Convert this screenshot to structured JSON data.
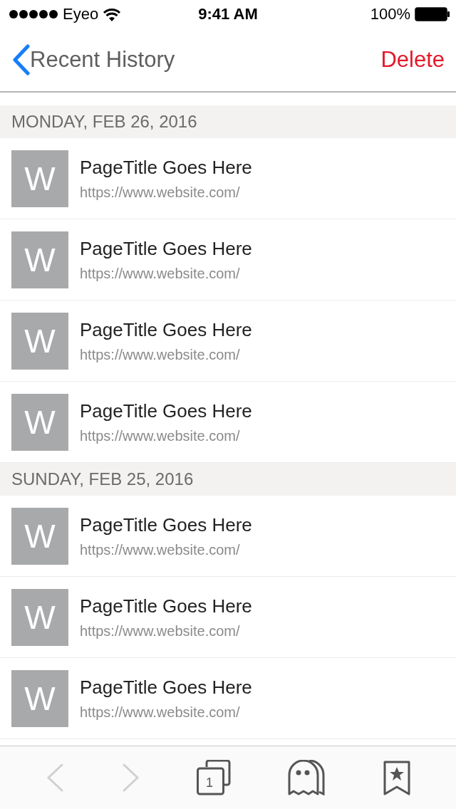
{
  "status_bar": {
    "carrier": "Eyeo",
    "time": "9:41 AM",
    "battery": "100%"
  },
  "nav": {
    "title": "Recent History",
    "action": "Delete"
  },
  "sections": [
    {
      "header": "MONDAY, FEB 26, 2016",
      "items": [
        {
          "letter": "W",
          "title": "PageTitle Goes Here",
          "url": "https://www.website.com/"
        },
        {
          "letter": "W",
          "title": "PageTitle Goes Here",
          "url": "https://www.website.com/"
        },
        {
          "letter": "W",
          "title": "PageTitle Goes Here",
          "url": "https://www.website.com/"
        },
        {
          "letter": "W",
          "title": "PageTitle Goes Here",
          "url": "https://www.website.com/"
        }
      ]
    },
    {
      "header": "SUNDAY, FEB 25, 2016",
      "items": [
        {
          "letter": "W",
          "title": "PageTitle Goes Here",
          "url": "https://www.website.com/"
        },
        {
          "letter": "W",
          "title": "PageTitle Goes Here",
          "url": "https://www.website.com/"
        },
        {
          "letter": "W",
          "title": "PageTitle Goes Here",
          "url": "https://www.website.com/"
        }
      ]
    }
  ],
  "toolbar": {
    "back": {
      "disabled": true
    },
    "forward": {
      "disabled": true
    },
    "tab_count": "1"
  }
}
